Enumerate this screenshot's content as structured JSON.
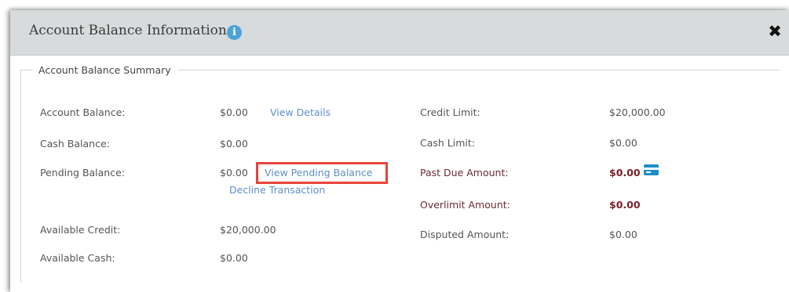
{
  "dialog": {
    "title": "Account Balance Information",
    "info_icon": "i",
    "close_icon": "✖"
  },
  "summary": {
    "legend": "Account Balance Summary",
    "account_balance_label": "Account Balance:",
    "account_balance_value": "$0.00",
    "view_details_link": "View Details",
    "cash_balance_label": "Cash Balance:",
    "cash_balance_value": "$0.00",
    "pending_balance_label": "Pending Balance:",
    "pending_balance_value": "$0.00",
    "view_pending_balance_link": "View Pending Balance",
    "decline_transaction_link": "Decline Transaction",
    "available_credit_label": "Available Credit:",
    "available_credit_value": "$20,000.00",
    "available_cash_label": "Available Cash:",
    "available_cash_value": "$0.00",
    "credit_limit_label": "Credit Limit:",
    "credit_limit_value": "$20,000.00",
    "cash_limit_label": "Cash Limit:",
    "cash_limit_value": "$0.00",
    "past_due_label": "Past Due Amount:",
    "past_due_value": "$0.00",
    "overlimit_label": "Overlimit Amount:",
    "overlimit_value": "$0.00",
    "disputed_label": "Disputed Amount:",
    "disputed_value": "$0.00"
  },
  "icons": {
    "info": "info-icon",
    "close": "close-icon",
    "card": "credit-card-icon"
  },
  "colors": {
    "header_bg": "#d7dbdc",
    "link": "#5e8fc8",
    "alert_value": "#7a1f2a",
    "highlight": "#e8433a",
    "info_icon": "#4ba3d9"
  }
}
